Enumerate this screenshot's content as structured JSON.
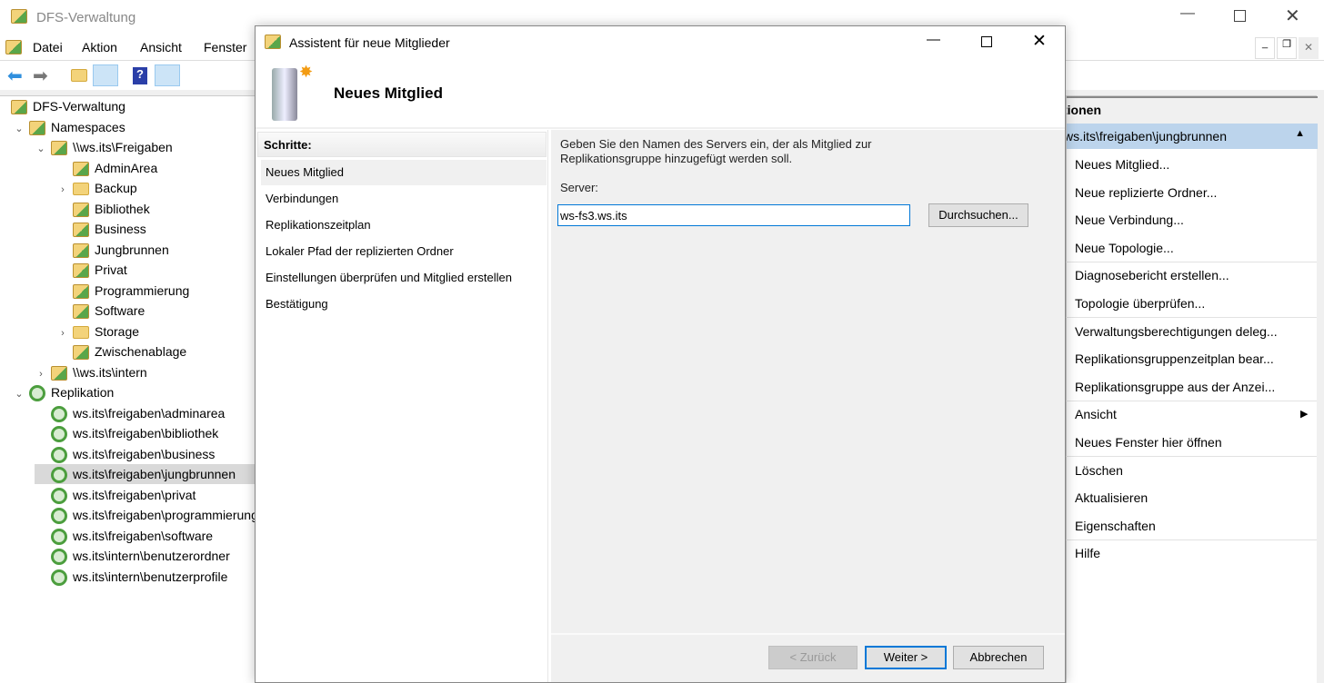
{
  "main_window": {
    "title": "DFS-Verwaltung",
    "menu": [
      "Datei",
      "Aktion",
      "Ansicht",
      "Fenster"
    ]
  },
  "tree": [
    {
      "label": "DFS-Verwaltung",
      "level": 0,
      "icon": "dfs-icon"
    },
    {
      "label": "Namespaces",
      "level": 1,
      "icon": "namespaces-icon",
      "expand": "v"
    },
    {
      "label": "\\\\ws.its\\Freigaben",
      "level": 2,
      "icon": "namespace-icon",
      "expand": "v"
    },
    {
      "label": "AdminArea",
      "level": 3,
      "icon": "share-icon"
    },
    {
      "label": "Backup",
      "level": 3,
      "icon": "folder-icon",
      "expand": ">"
    },
    {
      "label": "Bibliothek",
      "level": 3,
      "icon": "share-icon"
    },
    {
      "label": "Business",
      "level": 3,
      "icon": "share-icon"
    },
    {
      "label": "Jungbrunnen",
      "level": 3,
      "icon": "share-icon"
    },
    {
      "label": "Privat",
      "level": 3,
      "icon": "share-icon"
    },
    {
      "label": "Programmierung",
      "level": 3,
      "icon": "share-icon"
    },
    {
      "label": "Software",
      "level": 3,
      "icon": "share-icon"
    },
    {
      "label": "Storage",
      "level": 3,
      "icon": "folder-icon",
      "expand": ">"
    },
    {
      "label": "Zwischenablage",
      "level": 3,
      "icon": "share-icon"
    },
    {
      "label": "\\\\ws.its\\intern",
      "level": 2,
      "icon": "namespace-icon",
      "expand": ">"
    },
    {
      "label": "Replikation",
      "level": 1,
      "icon": "replication-icon",
      "expand": "v"
    },
    {
      "label": "ws.its\\freigaben\\adminarea",
      "level": 2,
      "icon": "replication-group-icon"
    },
    {
      "label": "ws.its\\freigaben\\bibliothek",
      "level": 2,
      "icon": "replication-group-icon"
    },
    {
      "label": "ws.its\\freigaben\\business",
      "level": 2,
      "icon": "replication-group-icon"
    },
    {
      "label": "ws.its\\freigaben\\jungbrunnen",
      "level": 2,
      "icon": "replication-group-icon",
      "selected": true
    },
    {
      "label": "ws.its\\freigaben\\privat",
      "level": 2,
      "icon": "replication-group-icon"
    },
    {
      "label": "ws.its\\freigaben\\programmierung",
      "level": 2,
      "icon": "replication-group-icon"
    },
    {
      "label": "ws.its\\freigaben\\software",
      "level": 2,
      "icon": "replication-group-icon"
    },
    {
      "label": "ws.its\\intern\\benutzerordner",
      "level": 2,
      "icon": "replication-group-icon"
    },
    {
      "label": "ws.its\\intern\\benutzerprofile",
      "level": 2,
      "icon": "replication-group-icon"
    }
  ],
  "actions": {
    "header": "Aktionen",
    "group": "ws.its\\freigaben\\jungbrunnen",
    "items": [
      "Neues Mitglied...",
      "Neue replizierte Ordner...",
      "Neue Verbindung...",
      "Neue Topologie...",
      "Diagnosebericht erstellen...",
      "Topologie überprüfen...",
      "Verwaltungsberechtigungen deleg...",
      "Replikationsgruppenzeitplan bear...",
      "Replikationsgruppe aus der Anzei...",
      "Ansicht",
      "Neues Fenster hier öffnen",
      "Löschen",
      "Aktualisieren",
      "Eigenschaften",
      "Hilfe"
    ]
  },
  "dialog": {
    "title": "Assistent für neue Mitglieder",
    "heading": "Neues Mitglied",
    "steps_header": "Schritte:",
    "steps": [
      "Neues Mitglied",
      "Verbindungen",
      "Replikationszeitplan",
      "Lokaler Pfad der replizierten Ordner",
      "Einstellungen überprüfen und Mitglied erstellen",
      "Bestätigung"
    ],
    "instruction": "Geben Sie den Namen des Servers ein, der als Mitglied zur Replikationsgruppe hinzugefügt werden soll.",
    "server_label": "Server:",
    "server_value": "ws-fs3.ws.its",
    "browse": "Durchsuchen...",
    "back": "< Zurück",
    "next": "Weiter >",
    "cancel": "Abbrechen"
  },
  "colors": {
    "selection": "#bcd4ec",
    "accent": "#0078d7"
  }
}
